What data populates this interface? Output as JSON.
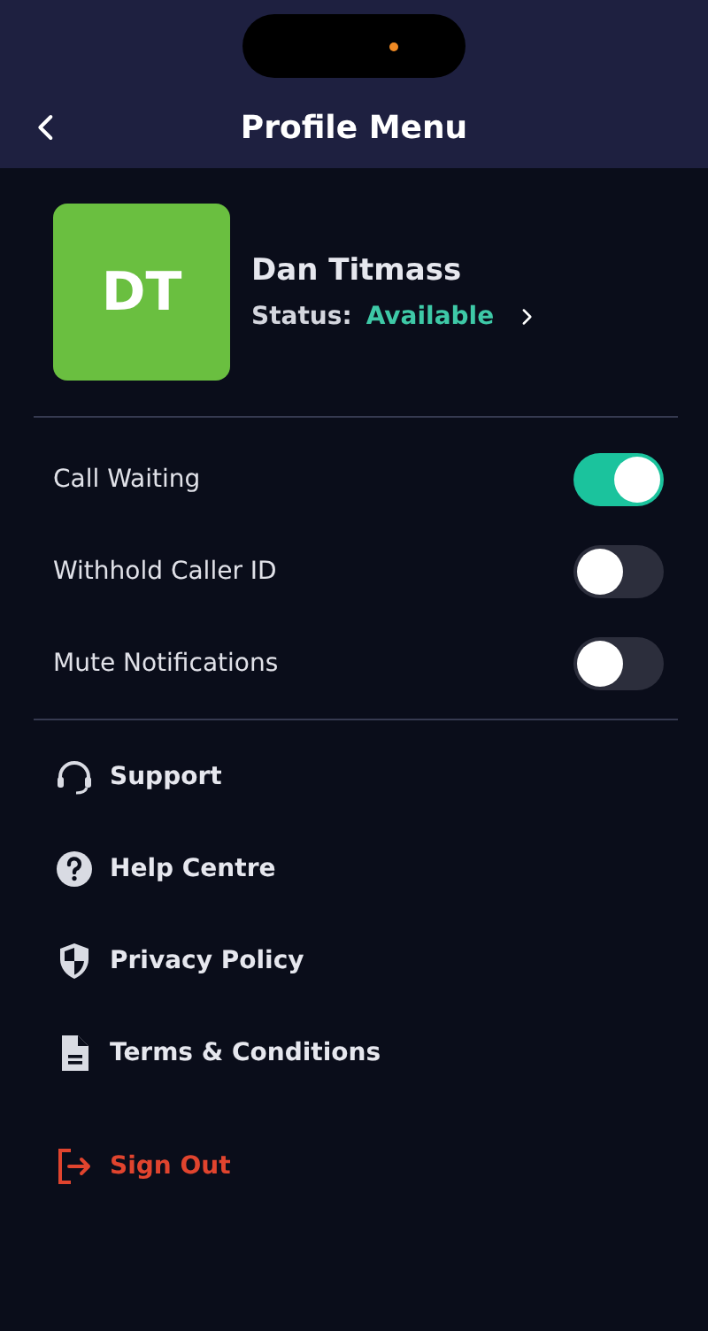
{
  "header": {
    "title": "Profile Menu"
  },
  "profile": {
    "initials": "DT",
    "name": "Dan Titmass",
    "status_label": "Status:",
    "status_value": "Available"
  },
  "settings": [
    {
      "label": "Call Waiting",
      "on": true
    },
    {
      "label": "Withhold Caller ID",
      "on": false
    },
    {
      "label": "Mute Notifications",
      "on": false
    }
  ],
  "menu": [
    {
      "label": "Support"
    },
    {
      "label": "Help Centre"
    },
    {
      "label": "Privacy Policy"
    },
    {
      "label": "Terms & Conditions"
    }
  ],
  "sign_out": {
    "label": "Sign Out"
  }
}
